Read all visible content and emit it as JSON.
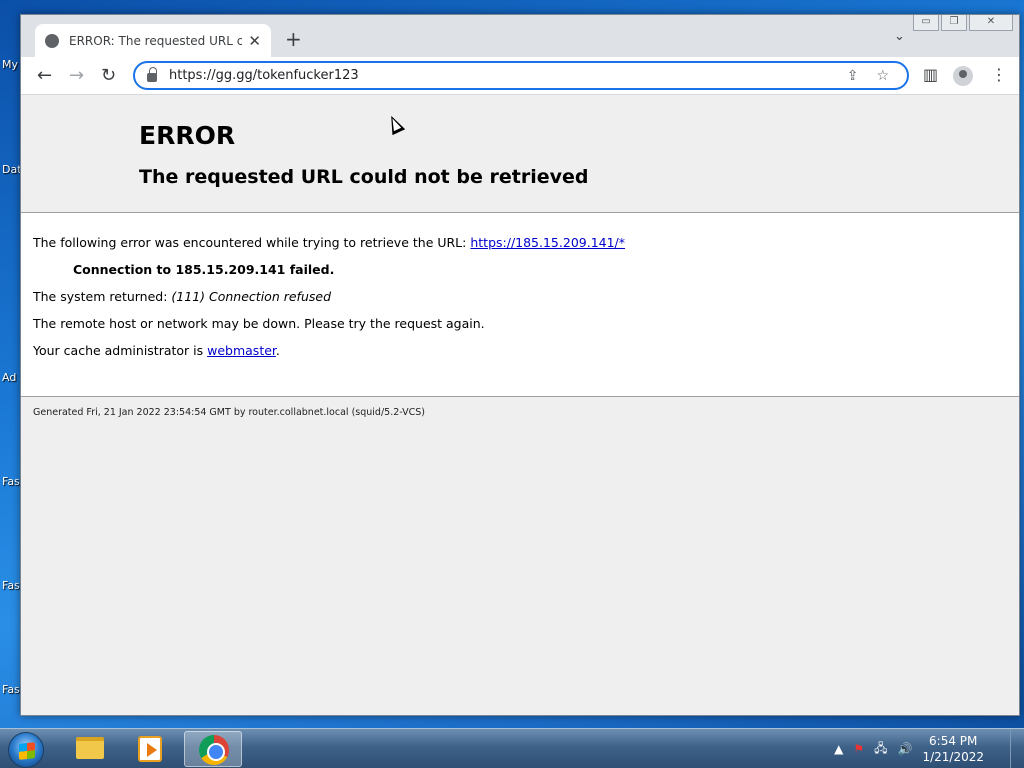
{
  "desktop": {
    "labels": [
      "My",
      "Dat",
      "Ad",
      "Fas",
      "Fas",
      "Fas"
    ]
  },
  "browser": {
    "tab_title": "ERROR: The requested URL could not be retrieved",
    "url": "https://gg.gg/tokenfucker123",
    "window_controls": {
      "minimize": "▭",
      "restore": "❐",
      "close": "✕"
    }
  },
  "page": {
    "heading": "ERROR",
    "subheading": "The requested URL could not be retrieved",
    "line1_prefix": "The following error was encountered while trying to retrieve the URL: ",
    "line1_link": "https://185.15.209.141/*",
    "line2": "Connection to 185.15.209.141 failed.",
    "line3_prefix": "The system returned: ",
    "line3_detail": "(111) Connection refused",
    "line4": "The remote host or network may be down. Please try the request again.",
    "line5_prefix": "Your cache administrator is ",
    "line5_link": "webmaster",
    "line5_suffix": ".",
    "footer": "Generated Fri, 21 Jan 2022 23:54:54 GMT by router.collabnet.local (squid/5.2-VCS)"
  },
  "taskbar": {
    "time": "6:54 PM",
    "date": "1/21/2022"
  },
  "colors": {
    "link": "#0000cc",
    "omnibox_focus": "#1a73e8"
  }
}
